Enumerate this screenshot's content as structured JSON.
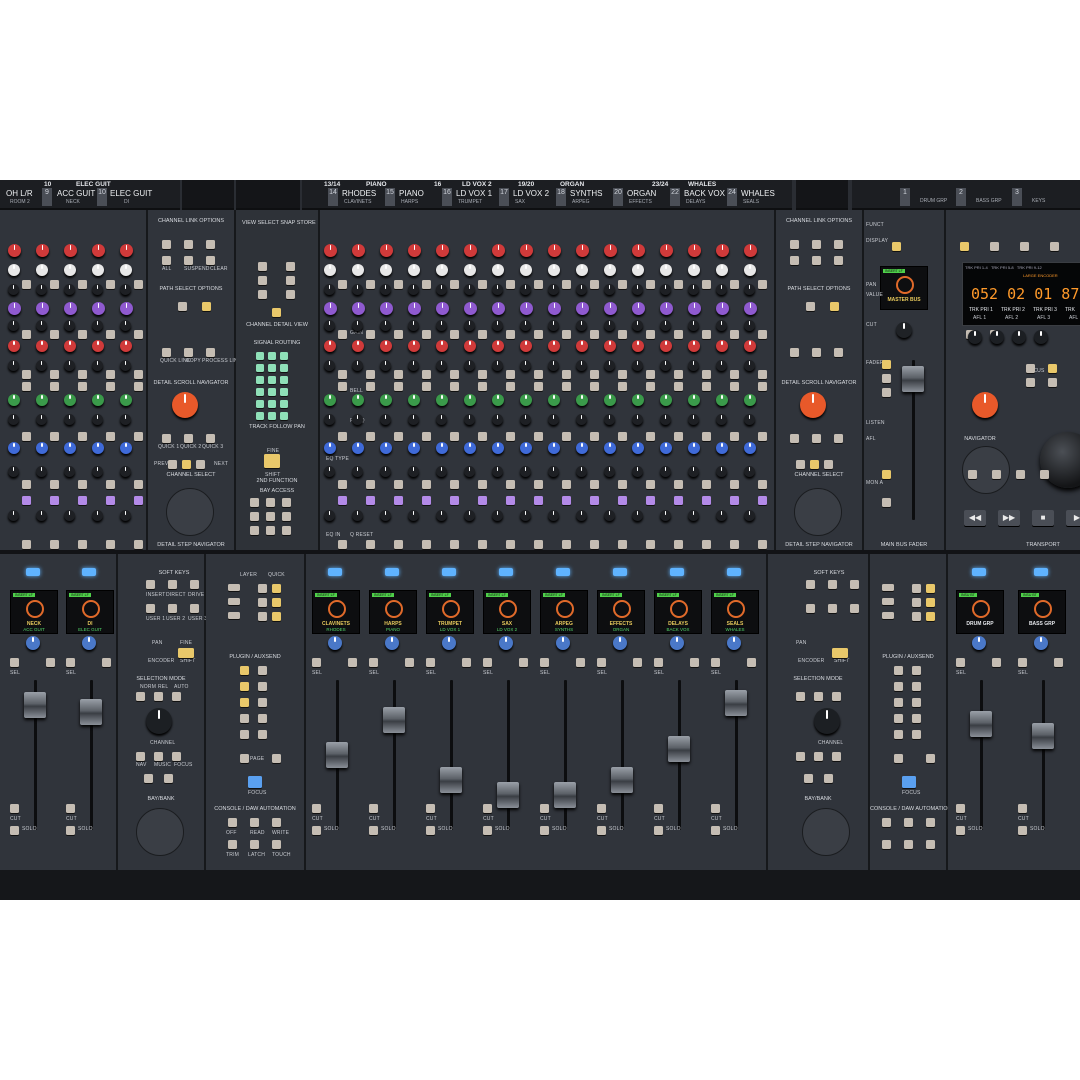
{
  "bridge": {
    "left_channels": [
      {
        "num": "10",
        "name": "ELEC GUIT"
      },
      {
        "name": "OH L/R",
        "num": "9",
        "sub": "ROOM 2"
      },
      {
        "name": "ACC GUIT",
        "num": "10",
        "sub": "NECK"
      },
      {
        "name": "ELEC GUIT",
        "sub": "DI"
      }
    ],
    "center_headers": [
      "13/14",
      "PIANO",
      "16",
      "LD VOX 2",
      "19/20",
      "ORGAN",
      "23/24",
      "WHALES"
    ],
    "center_channels": [
      {
        "name": "RHODES",
        "sub": "CLAVINETS",
        "num": "14"
      },
      {
        "name": "PIANO",
        "sub": "HARPS",
        "num": "15"
      },
      {
        "name": "LD VOX 1",
        "sub": "TRUMPET",
        "num": "16"
      },
      {
        "name": "LD VOX 2",
        "sub": "SAX",
        "num": "17"
      },
      {
        "name": "SYNTHS",
        "sub": "ARPEG",
        "num": "18"
      },
      {
        "name": "ORGAN",
        "sub": "EFFECTS",
        "num": "20"
      },
      {
        "name": "BACK VOX",
        "sub": "DELAYS",
        "num": "22"
      },
      {
        "name": "WHALES",
        "sub": "SEALS",
        "num": "24"
      }
    ],
    "right_groups": [
      {
        "num": "1",
        "name": "DRUM GRP"
      },
      {
        "num": "2",
        "name": "BASS GRP"
      },
      {
        "num": "3",
        "name": "KEYS"
      }
    ]
  },
  "upper_left": {
    "channel_link": "CHANNEL LINK OPTIONS",
    "path_select": "PATH SELECT OPTIONS",
    "scroll_nav": "DETAIL SCROLL NAVIGATOR",
    "channel_select": "CHANNEL SELECT",
    "step_nav": "DETAIL STEP NAVIGATOR",
    "link_btns": [
      "ALL",
      "SUSPEND",
      "CLEAR"
    ],
    "path_btns": [
      "QUICK LINK",
      "COPY",
      "PROCESS LINKS"
    ],
    "quick_btns": [
      "QUICK 1",
      "QUICK 2",
      "QUICK 3"
    ],
    "nav_btns": [
      "PREV",
      "NEXT"
    ]
  },
  "upper_center": {
    "view_select": "VIEW SELECT",
    "snap_store": "SNAP STORE",
    "channel_detail_view": "CHANNEL DETAIL VIEW",
    "signal_routing": "SIGNAL ROUTING",
    "track_follow_pan": "TRACK FOLLOW PAN",
    "fine": "FINE",
    "shift": "SHIFT",
    "second_function": "2nd FUNCTION",
    "bay_access": "BAY ACCESS"
  },
  "strip_labels": {
    "gain": "GAIN",
    "bell": "BELL",
    "eq_type": "EQ TYPE",
    "freq": "FREQ",
    "eq_in": "EQ IN",
    "q_reset": "Q RESET"
  },
  "upper_right": {
    "channel_link": "CHANNEL LINK OPTIONS",
    "path_select": "PATH SELECT OPTIONS",
    "scroll_nav": "DETAIL SCROLL NAVIGATOR",
    "channel_select": "CHANNEL SELECT",
    "step_nav": "DETAIL STEP NAVIGATOR"
  },
  "master": {
    "lcd_tag": "INSERT LF",
    "lcd_name": "MASTER BUS",
    "fader_label": "MAIN BUS FADER",
    "side_labels": [
      "FUNCT",
      "DISPLAY",
      "PAN",
      "VALUE",
      "CUT",
      "FADER",
      "LISTEN",
      "AFL",
      "MON A"
    ]
  },
  "transport": {
    "label": "TRANSPORT",
    "navigator": "NAVIGATOR",
    "focus": "FOCUS",
    "focus2": "FOCUS",
    "display_tabs": [
      "TRK PRI 1-4",
      "TRK PRI 5-8",
      "TRK PRI 9-12"
    ],
    "display_title": "LARGE ENCODER",
    "timecode": "052 02 01 879",
    "trk": [
      "TRK PRI 1",
      "TRK PRI 2",
      "TRK PRI 3",
      "TRK"
    ],
    "afl": [
      "AFL 1",
      "AFL 2",
      "AFL 3",
      "AFL"
    ],
    "buttons": [
      "◀◀",
      "▶▶",
      "■",
      "▶"
    ]
  },
  "lower_left": {
    "strips": [
      {
        "name": "NECK",
        "sub": "ACC GUIT"
      },
      {
        "name": "DI",
        "sub": "ELEC GUIT"
      }
    ],
    "soft_keys": "SOFT KEYS",
    "soft_btns": [
      "INSERT",
      "DIRECT",
      "DRIVE",
      "USER 1",
      "USER 2",
      "USER 3"
    ],
    "pan": "PAN",
    "fine": "FINE",
    "encoder": "ENCODER",
    "shift": "SHIFT",
    "selection_mode": "SELECTION MODE",
    "sel_btns": [
      "NORM",
      "REL",
      "AUTO"
    ],
    "channel": "CHANNEL",
    "nav_btns": [
      "NAV",
      "MUSIC",
      "FOCUS"
    ],
    "bay_bank": "BAY/BANK",
    "strip_btns": [
      "SEL",
      "CUT",
      "SOLO"
    ]
  },
  "lower_center": {
    "layer": "LAYER",
    "quick": "QUICK",
    "plugin_auxsend": "PLUGIN / AUXSEND",
    "page": "PAGE",
    "focus": "FOCUS",
    "console_daw": "CONSOLE / DAW AUTOMATION",
    "auto_btns": [
      "OFF",
      "READ",
      "WRITE",
      "TRIM",
      "LATCH",
      "TOUCH"
    ],
    "strips": [
      {
        "name": "CLAVINETS",
        "sub": "RHODES",
        "level": 0.5
      },
      {
        "name": "HARPS",
        "sub": "PIANO",
        "level": 0.78
      },
      {
        "name": "TRUMPET",
        "sub": "LD VOX 1",
        "level": 0.3
      },
      {
        "name": "SAX",
        "sub": "LD VOX 2",
        "level": 0.18
      },
      {
        "name": "ARPEG",
        "sub": "SYNTHS",
        "level": 0.18
      },
      {
        "name": "EFFECTS",
        "sub": "ORGAN",
        "level": 0.3
      },
      {
        "name": "DELAYS",
        "sub": "BACK VOX",
        "level": 0.55
      },
      {
        "name": "SEALS",
        "sub": "WHALES",
        "level": 0.92
      }
    ]
  },
  "lower_right": {
    "soft_keys": "SOFT KEYS",
    "selection_mode": "SELECTION MODE",
    "channel": "CHANNEL",
    "bay_bank": "BAY/BANK",
    "pan": "PAN",
    "encoder": "ENCODER",
    "shift": "SHIFT",
    "plugin_auxsend": "PLUGIN / AUXSEND",
    "console_daw": "CONSOLE / DAW AUTOMATION",
    "focus": "FOCUS",
    "groups": [
      {
        "name": "DRUM GRP",
        "tag": "INSU BT"
      },
      {
        "name": "BASS GRP",
        "tag": "INSU BT"
      }
    ]
  }
}
